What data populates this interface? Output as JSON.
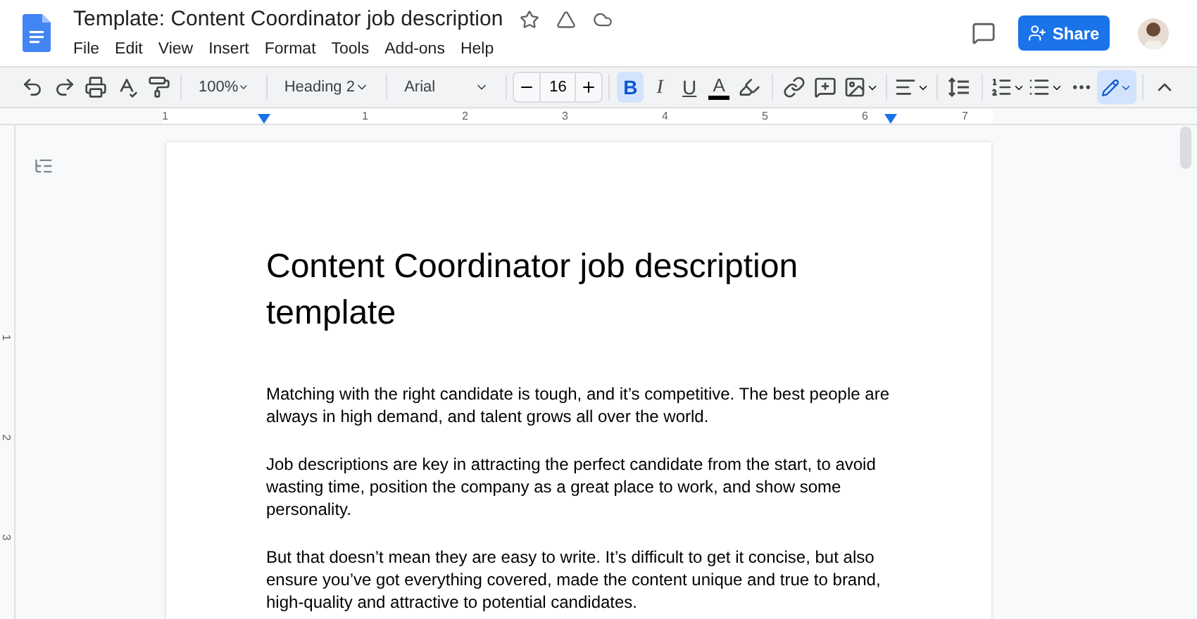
{
  "doc_title": "Template: Content Coordinator job description",
  "menu": [
    "File",
    "Edit",
    "View",
    "Insert",
    "Format",
    "Tools",
    "Add-ons",
    "Help"
  ],
  "share_label": "Share",
  "toolbar": {
    "zoom": "100%",
    "style": "Heading 2",
    "font": "Arial",
    "font_size": "16",
    "format_buttons": [
      {
        "label": "B",
        "selected": true
      },
      {
        "label": "I",
        "selected": false
      },
      {
        "label": "U",
        "selected": false
      }
    ],
    "text_color_label": "A"
  },
  "ruler": {
    "horizontal": [
      "1",
      "1",
      "2",
      "3",
      "4",
      "5",
      "6",
      "7"
    ],
    "vertical": [
      "1",
      "2",
      "3"
    ]
  },
  "document": {
    "heading": "Content Coordinator job description template",
    "paragraphs": [
      "Matching with the right candidate is tough, and it’s competitive. The best people are always in high demand, and talent grows all over the world.",
      "Job descriptions are key in attracting the perfect candidate from the start, to avoid wasting time, position the company as a great place to work, and show some personality.",
      "But that doesn’t mean they are easy to write. It’s difficult to get it concise, but also ensure you’ve got everything covered, made the content unique and true to brand, high-quality and attractive to potential candidates."
    ]
  }
}
